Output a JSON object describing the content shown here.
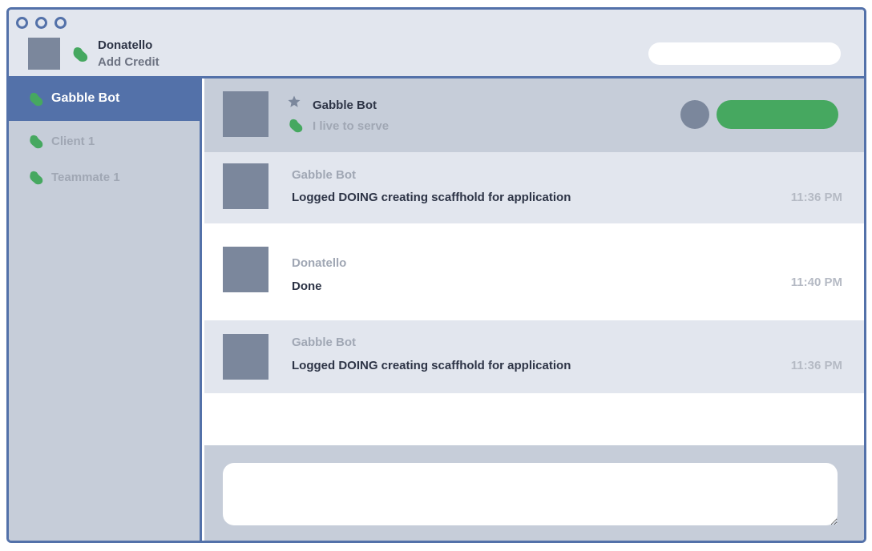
{
  "window": {
    "controls": [
      "close",
      "minimize",
      "maximize"
    ]
  },
  "user": {
    "name": "Donatello",
    "subtitle": "Add Credit",
    "status_icon": "presence-blob-icon",
    "status_color": "#46a860"
  },
  "search": {
    "placeholder": ""
  },
  "sidebar": {
    "items": [
      {
        "label": "Gabble Bot",
        "active": true
      },
      {
        "label": "Client 1",
        "active": false
      },
      {
        "label": "Teammate 1",
        "active": false
      }
    ]
  },
  "chat_header": {
    "name": "Gabble Bot",
    "tagline": "I live to serve",
    "favorite_icon": "star-icon"
  },
  "messages": [
    {
      "sender": "Gabble Bot",
      "text": "Logged DOING creating scaffhold for application",
      "time": "11:36 PM"
    },
    {
      "sender": "Donatello",
      "text": "Done",
      "time": "11:40 PM"
    },
    {
      "sender": "Gabble Bot",
      "text": "Logged DOING creating scaffhold for application",
      "time": "11:36 PM"
    }
  ],
  "composer": {
    "placeholder": ""
  },
  "colors": {
    "accent": "#5371a9",
    "online": "#46a860",
    "panel": "#c6cdd9",
    "shade": "#e2e6ee"
  }
}
